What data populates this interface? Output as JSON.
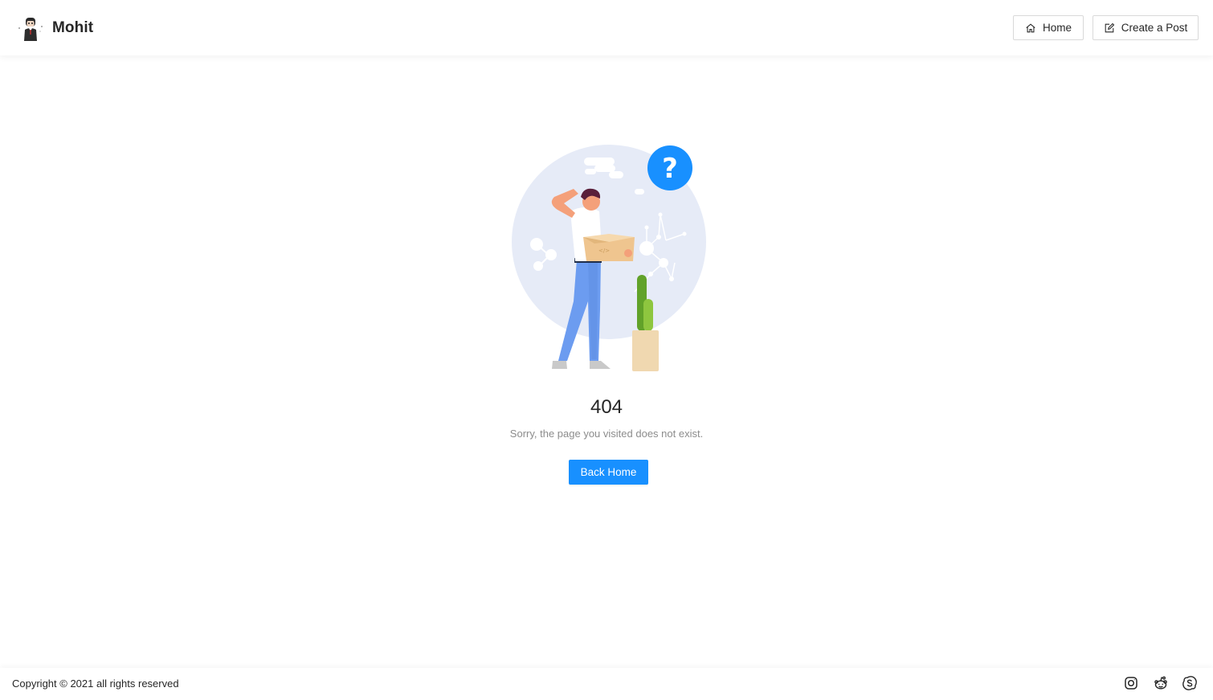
{
  "header": {
    "brand_name": "Mohit",
    "nav": [
      {
        "label": "Home",
        "icon": "home-icon"
      },
      {
        "label": "Create a Post",
        "icon": "edit-icon"
      }
    ]
  },
  "main": {
    "illustration": "404-illustration",
    "status_code": "404",
    "message": "Sorry, the page you visited does not exist.",
    "back_button_label": "Back Home"
  },
  "footer": {
    "copyright": "Copyright © 2021 all rights reserved",
    "social_icons": [
      "instagram-icon",
      "reddit-icon",
      "skype-icon"
    ]
  },
  "colors": {
    "primary": "#1890ff",
    "text": "#262626",
    "secondary_text": "#8c8c8c",
    "border": "#d9d9d9"
  }
}
